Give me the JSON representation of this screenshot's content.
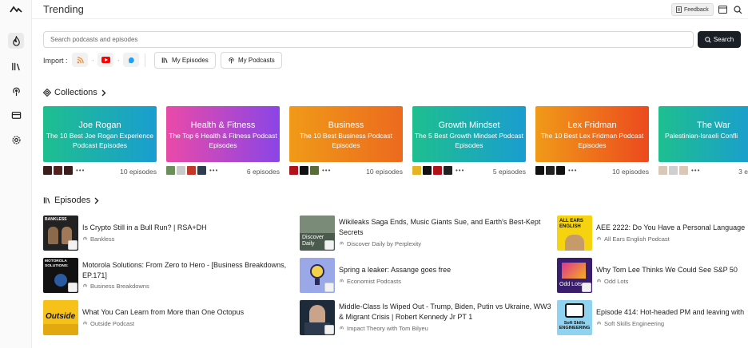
{
  "header": {
    "title": "Trending",
    "feedback_label": "Feedback"
  },
  "search": {
    "placeholder": "Search podcasts and episodes",
    "button_label": "Search"
  },
  "import": {
    "label": "Import :",
    "sources": [
      {
        "icon": "rss-icon",
        "color": "#f58220"
      },
      {
        "icon": "youtube-icon",
        "color": "#ff0000"
      },
      {
        "icon": "chat-bubble-icon",
        "color": "#1da1f2"
      }
    ],
    "my_episodes_label": "My Episodes",
    "my_podcasts_label": "My Podcasts"
  },
  "collections": {
    "title": "Collections",
    "items": [
      {
        "title": "Joe Rogan",
        "subtitle": "The 10 Best Joe Rogan Experience Podcast Episodes",
        "count": "10 episodes",
        "gradient": [
          "#1ebf8f",
          "#1a9dd0"
        ]
      },
      {
        "title": "Health & Fitness",
        "subtitle": "The Top 6 Health & Fitness Podcast Episodes",
        "count": "6 episodes",
        "gradient": [
          "#ea4aa8",
          "#8a45e6"
        ]
      },
      {
        "title": "Business",
        "subtitle": "The 10 Best Business Podcast Episodes",
        "count": "10 episodes",
        "gradient": [
          "#f09a18",
          "#ec6a1e"
        ]
      },
      {
        "title": "Growth Mindset",
        "subtitle": "The 5 Best Growth Mindset Podcast Episodes",
        "count": "5 episodes",
        "gradient": [
          "#1ebf8f",
          "#1a9dd0"
        ]
      },
      {
        "title": "Lex Fridman",
        "subtitle": "The 10 Best Lex Fridman Podcast Episodes",
        "count": "10 episodes",
        "gradient": [
          "#f09a18",
          "#ec4a1e"
        ]
      },
      {
        "title": "The War",
        "subtitle": "Palestinian-Israeli Confli",
        "count": "3 e",
        "gradient": [
          "#1ebf8f",
          "#1a9dd0"
        ]
      }
    ]
  },
  "episodes": {
    "title": "Episodes",
    "items": [
      {
        "title": "Is Crypto Still in a Bull Run? | RSA+DH",
        "podcast": "Bankless",
        "art_text": "BANKLESS",
        "art_bg": "#222222",
        "art_fg": "#ffffff"
      },
      {
        "title": "Motorola Solutions: From Zero to Hero - [Business Breakdowns, EP.171]",
        "podcast": "Business Breakdowns",
        "art_text": "MOTOROLA SOLUTIONS:",
        "art_bg": "#111111",
        "art_fg": "#ffffff"
      },
      {
        "title": "What You Can Learn from More than One Octopus",
        "podcast": "Outside Podcast",
        "art_text": "Outside",
        "art_bg": "#f6c21a",
        "art_fg": "#111111"
      },
      {
        "title": "Wikileaks Saga Ends, Music Giants Sue, and Earth's Best-Kept Secrets",
        "podcast": "Discover Daily by Perplexity",
        "art_text": "Discover Daily",
        "art_bg": "#4a5a4c",
        "art_fg": "#ffffff"
      },
      {
        "title": "Spring a leaker: Assange goes free",
        "podcast": "Economist Podcasts",
        "art_text": "",
        "art_bg": "#9aa8e8",
        "art_fg": "#ffffff"
      },
      {
        "title": "Middle-Class Is Wiped Out - Trump, Biden, Putin vs Ukraine, WW3 & Migrant Crisis | Robert Kennedy Jr PT 1",
        "podcast": "Impact Theory with Tom Bilyeu",
        "art_text": "",
        "art_bg": "#1d2a3a",
        "art_fg": "#ffffff"
      },
      {
        "title": "AEE 2222: Do You Have a Personal Language",
        "podcast": "All Ears English Podcast",
        "art_text": "ALL EARS ENGLISH",
        "art_bg": "#f5d40f",
        "art_fg": "#111111"
      },
      {
        "title": "Why Tom Lee Thinks We Could See S&P 50",
        "podcast": "Odd Lots",
        "art_text": "Odd Lots",
        "art_bg": "#3b1d6e",
        "art_fg": "#ffffff"
      },
      {
        "title": "Episode 414: Hot-headed PM and leaving with",
        "podcast": "Soft Skills Engineering",
        "art_text": "Soft Skills ENGINEERING",
        "art_bg": "#8fd3f0",
        "art_fg": "#111111"
      }
    ]
  },
  "colors": {
    "accent_dark": "#1a1f26",
    "text": "#222222",
    "muted": "#666666"
  }
}
